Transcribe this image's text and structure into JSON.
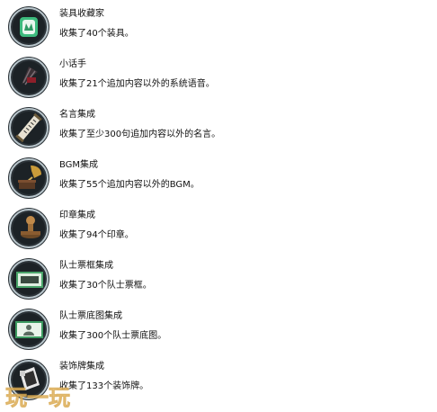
{
  "achievements": [
    {
      "title": "装具收藏家",
      "desc": "收集了40个装具。",
      "icon": "card-icon"
    },
    {
      "title": "小话手",
      "desc": "收集了21个追加内容以外的系统语音。",
      "icon": "fan-icon"
    },
    {
      "title": "名言集成",
      "desc": "收集了至少300句追加内容以外的名言。",
      "icon": "scroll-icon"
    },
    {
      "title": "BGM集成",
      "desc": "收集了55个追加内容以外的BGM。",
      "icon": "gramophone-icon"
    },
    {
      "title": "印章集成",
      "desc": "收集了94个印章。",
      "icon": "stamp-icon"
    },
    {
      "title": "队士票框集成",
      "desc": "收集了30个队士票框。",
      "icon": "ticket-frame-icon"
    },
    {
      "title": "队士票底图集成",
      "desc": "收集了300个队士票底图。",
      "icon": "ticket-background-icon"
    },
    {
      "title": "装饰牌集成",
      "desc": "收集了133个装饰牌。",
      "icon": "decoration-plate-icon"
    }
  ],
  "watermark": {
    "text": "玩一玩"
  }
}
